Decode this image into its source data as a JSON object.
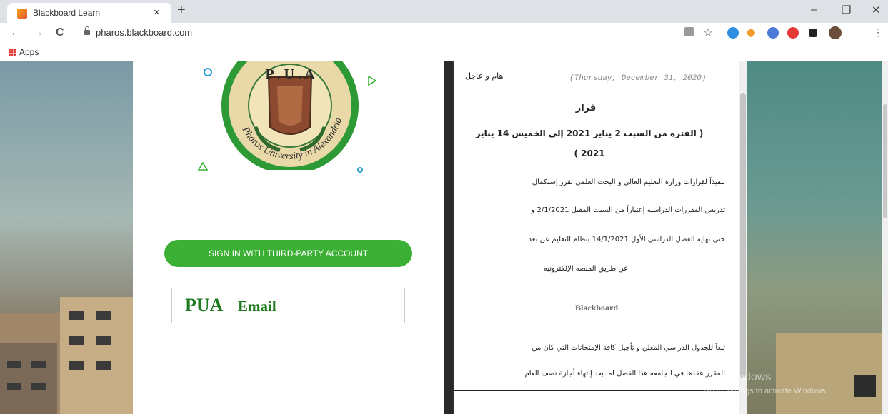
{
  "browser": {
    "tab_title": "Blackboard Learn",
    "tab_close": "×",
    "new_tab": "+",
    "minimize": "–",
    "maximize": "❐",
    "close": "✕",
    "back": "←",
    "forward": "→",
    "reload": "C",
    "url": "pharos.blackboard.com",
    "bookmark_apps": "Apps",
    "star": "☆",
    "menu": "⋮"
  },
  "login": {
    "logo_top_text": "P . U . A",
    "logo_ring_text": "Pharos University in Alexandria",
    "signin_button": "SIGN IN WITH THIRD-PARTY ACCOUNT",
    "email_brand": "PUA",
    "email_word": "Email"
  },
  "notice": {
    "date": "(Thursday, December 31, 2020)",
    "urgent": "هام و عاجل",
    "title": "قرار",
    "period_line1": "(    الفتره من السبت 2 يناير 2021 إلى الخميس 14 يناير",
    "period_line2": "2021    )",
    "para1": "تنفيذاً لقرارات وزارة التعليم العالي و البحث العلمي تقرر إستكمال",
    "para2": "تدريس المقررات الدراسيه إعتباراً من السبت المقبل 2/1/2021 و",
    "para3": "حتى نهاية الفصل الدراسي الأول 14/1/2021 بنظام التعليم عن بعد",
    "para4": "عن طريق المنصه الإلكترونيه",
    "platform": "Blackboard",
    "para5": "تبعاً للجدول الدراسي المعلن و تأجيل كافة الإمتحانات التي كان من",
    "para6": "المقرر عقدها في الجامعه هذا الفصل لما بعد إنتهاء أجازة نصف العام"
  },
  "watermark": {
    "line1": "Activate Windows",
    "line2": "Go to Settings to activate Windows."
  },
  "colors": {
    "signin_green": "#3cb034",
    "email_green": "#1e7a1e"
  }
}
